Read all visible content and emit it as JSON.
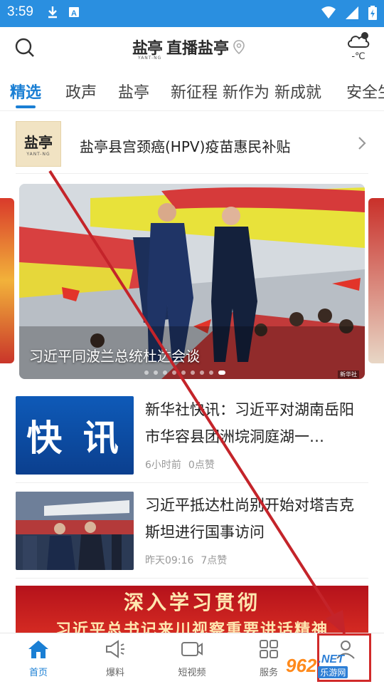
{
  "status_bar": {
    "time": "3:59",
    "left_icons": [
      "download-icon",
      "app-a-icon"
    ],
    "right_icons": [
      "wifi-icon",
      "signal-icon",
      "battery-icon"
    ]
  },
  "header": {
    "logo_mark": "盐亭",
    "logo_sub": "YANT-NG",
    "title": "直播盐亭",
    "weather_temp": "-℃"
  },
  "tabs": [
    {
      "label": "精选",
      "active": true
    },
    {
      "label": "政声"
    },
    {
      "label": "盐亭"
    },
    {
      "label": "新征程 新作为 新成就"
    },
    {
      "label": "安全生"
    }
  ],
  "promo": {
    "logo_text": "盐亭",
    "logo_sub": "YANT-NG",
    "text": "盐亭县宫颈癌(HPV)疫苗惠民补贴"
  },
  "carousel": {
    "caption": "习近平同波兰总统杜达会谈",
    "dot_count": 9,
    "active_dot": 8,
    "badge": "新华社"
  },
  "news": [
    {
      "thumb_text": "快 讯",
      "title": "新华社快讯：习近平对湖南岳阳市华容县团洲垸洞庭湖一…",
      "time": "6小时前",
      "likes": "0点赞"
    },
    {
      "title": "习近平抵达杜尚别开始对塔吉克斯坦进行国事访问",
      "time": "昨天09:16",
      "likes": "7点赞"
    }
  ],
  "banner": {
    "line1": "深入学习贯彻",
    "line2": "习近平总书记来川视察重要讲话精神"
  },
  "bottom_nav": [
    {
      "label": "首页",
      "icon": "home-icon",
      "active": true
    },
    {
      "label": "爆料",
      "icon": "megaphone-icon"
    },
    {
      "label": "短视频",
      "icon": "video-icon"
    },
    {
      "label": "服务",
      "icon": "grid-icon"
    },
    {
      "label": "",
      "icon": "user-icon"
    }
  ],
  "watermark": {
    "num": "962",
    "net": ".NET",
    "cn": "乐游网"
  },
  "colors": {
    "status_bar": "#2a8fe0",
    "accent": "#1a7fd4",
    "annotation_red": "#d12a2a"
  }
}
